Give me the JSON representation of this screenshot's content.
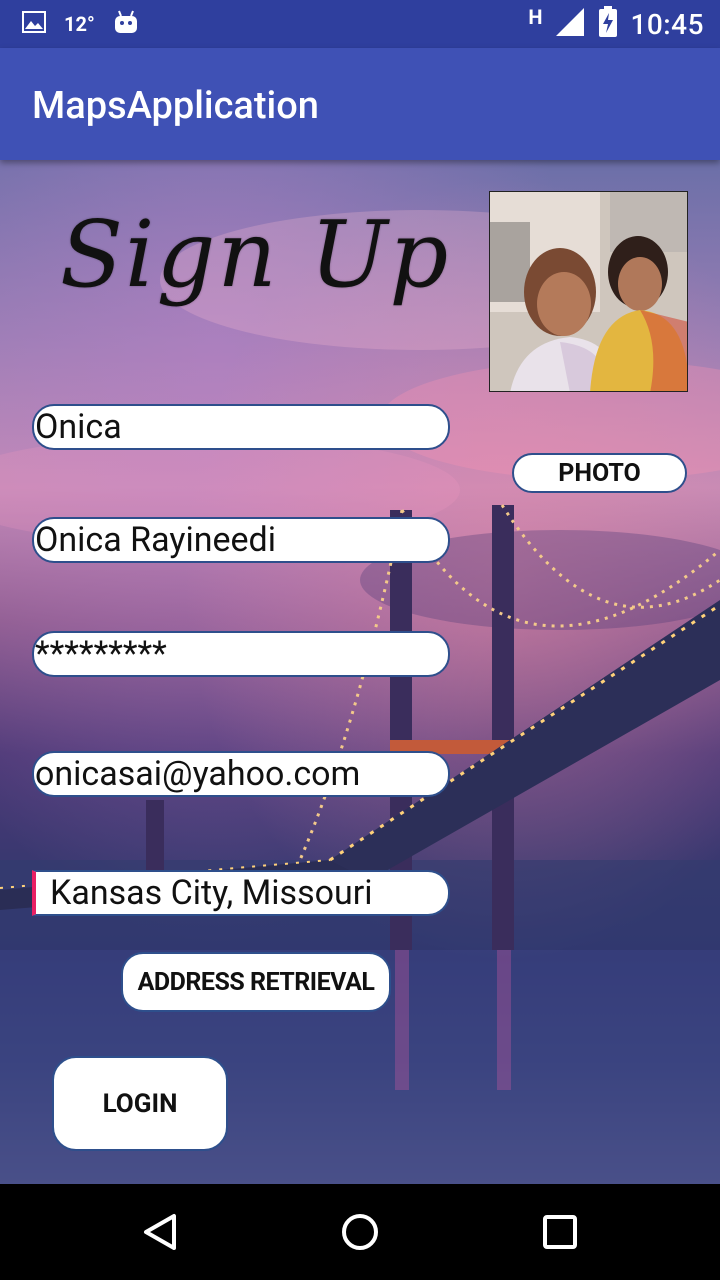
{
  "status_bar": {
    "temperature": "12°",
    "network_type": "H",
    "time": "10:45",
    "icons": [
      "image-icon",
      "android-icon",
      "signal-icon",
      "battery-charging-icon"
    ]
  },
  "app_bar": {
    "title": "MapsApplication",
    "color": "#3f51b5"
  },
  "form": {
    "heading": "Sign Up",
    "username_value": "Onica",
    "fullname_value": "Onica Rayineedi",
    "password_value": "*********",
    "email_value": "onicasai@yahoo.com",
    "address_value": "Kansas City, Missouri",
    "photo_button_label": "PHOTO",
    "address_button_label": "ADDRESS RETRIEVAL",
    "login_button_label": "LOGIN"
  },
  "nav_bar": {
    "icons": [
      "back-icon",
      "home-icon",
      "recents-icon"
    ]
  },
  "colors": {
    "status_bar": "#2f3f9e",
    "app_bar": "#3f51b5",
    "field_border": "#2e4f8c",
    "cursor_accent": "#e91e63"
  }
}
